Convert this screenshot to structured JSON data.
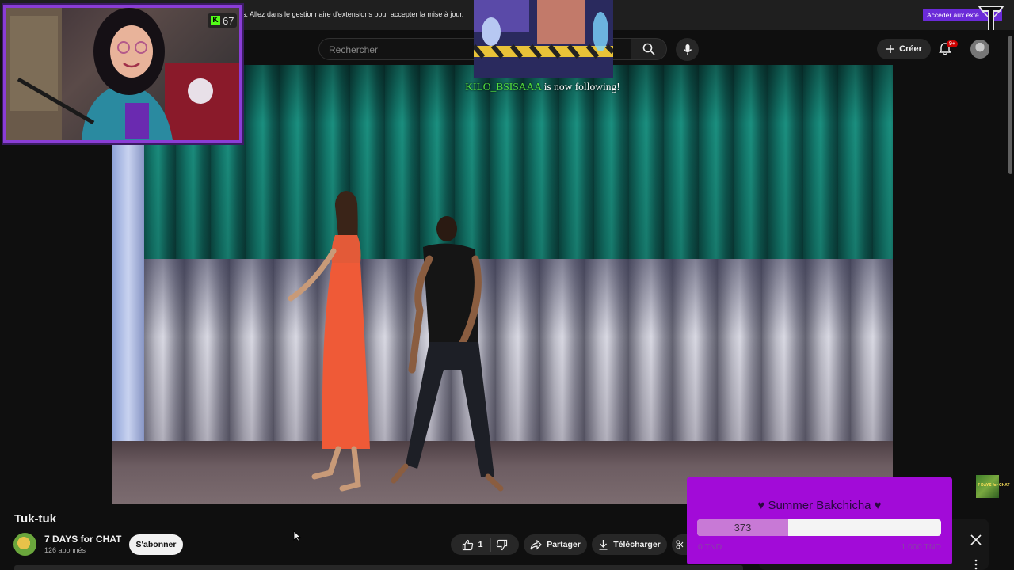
{
  "notification": {
    "text": "s. Allez dans le gestionnaire d'extensions pour accepter la mise à jour.",
    "button_label": "Accéder aux exte"
  },
  "masthead": {
    "search_placeholder": "Rechercher",
    "create_label": "Créer",
    "notifications_badge": "9+"
  },
  "webcam": {
    "viewer_count": "67"
  },
  "follow_alert": {
    "username": "KILO_BSISAAA",
    "message": " is now following!"
  },
  "video": {
    "title": "Tuk-tuk",
    "channel_name": "7 DAYS for CHAT",
    "subscribers": "126 abonnés",
    "subscribe_label": "S'abonner",
    "like_count": "1",
    "share_label": "Partager",
    "download_label": "Télécharger"
  },
  "donation_goal": {
    "title": "♥ Summer Bakchicha ♥",
    "current": "373",
    "progress_fraction": 0.373,
    "min_label": "0 TND",
    "max_label": "1 000 TND",
    "color": "#a20bd8"
  },
  "side_thumb": {
    "text": "7 DAYS for CHAT"
  },
  "colors": {
    "accent_purple": "#6b2bd8",
    "kick_green": "#53fc18",
    "follow_name": "#53e03c",
    "youtube_bg": "#0f0f0f"
  }
}
